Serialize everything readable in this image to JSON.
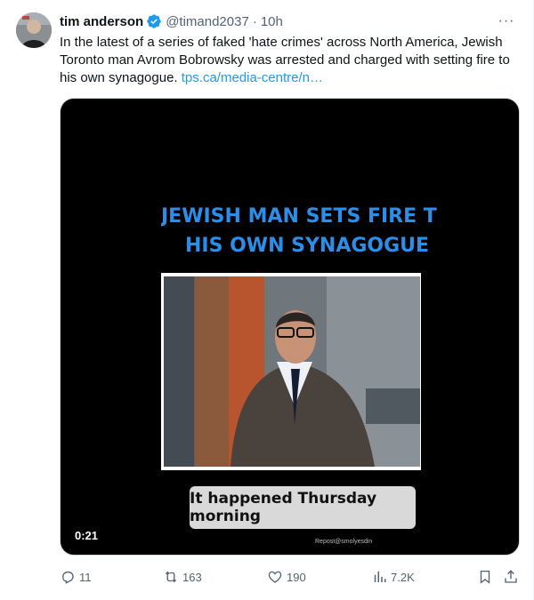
{
  "author": {
    "name": "tim anderson",
    "handle": "@timand2037",
    "separator": "·",
    "time": "10h",
    "verified": true
  },
  "more_label": "···",
  "tweet": {
    "text": "In the latest of a series of faked 'hate crimes' across North America, Jewish Toronto man Avrom Bobrowsky was arrested and charged with setting fire to his own synagogue.",
    "link": "tps.ca/media-centre/n…"
  },
  "video": {
    "headline_line1": "JEWISH MAN SETS FIRE T",
    "headline_line2": "HIS OWN SYNAGOGUE",
    "subtitle": "It happened Thursday morning",
    "watermark": "Repost@smolyesdin",
    "timecode": "0:21"
  },
  "actions": {
    "replies": "11",
    "reposts": "163",
    "likes": "190",
    "views": "7.2K"
  },
  "colors": {
    "link": "#1d9bf0",
    "verified": "#1d9bf0",
    "secondary_text": "#536471",
    "headline": "#2b8ee8"
  }
}
